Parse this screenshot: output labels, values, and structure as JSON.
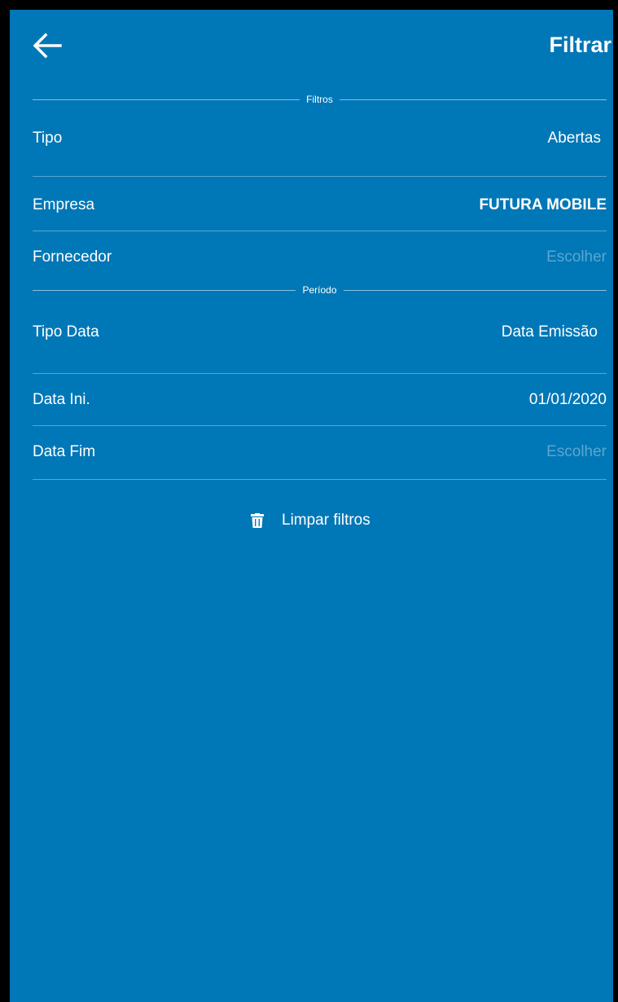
{
  "header": {
    "back_icon": "arrow-left-icon",
    "action_label": "Filtrar"
  },
  "sections": {
    "filtros_title": "Filtros",
    "periodo_title": "Período"
  },
  "filters": {
    "tipo": {
      "label": "Tipo",
      "value": "Abertas"
    },
    "empresa": {
      "label": "Empresa",
      "value": "FUTURA MOBILE"
    },
    "fornecedor": {
      "label": "Fornecedor",
      "value": "Escolher"
    },
    "tipo_data": {
      "label": "Tipo Data",
      "value": "Data Emissão"
    },
    "data_ini": {
      "label": "Data Ini.",
      "value": "01/01/2020"
    },
    "data_fim": {
      "label": "Data Fim",
      "value": "Escolher"
    }
  },
  "clear": {
    "icon": "trash-icon",
    "label": "Limpar filtros"
  },
  "colors": {
    "background": "#0077B6",
    "text": "#FFFFFF"
  }
}
